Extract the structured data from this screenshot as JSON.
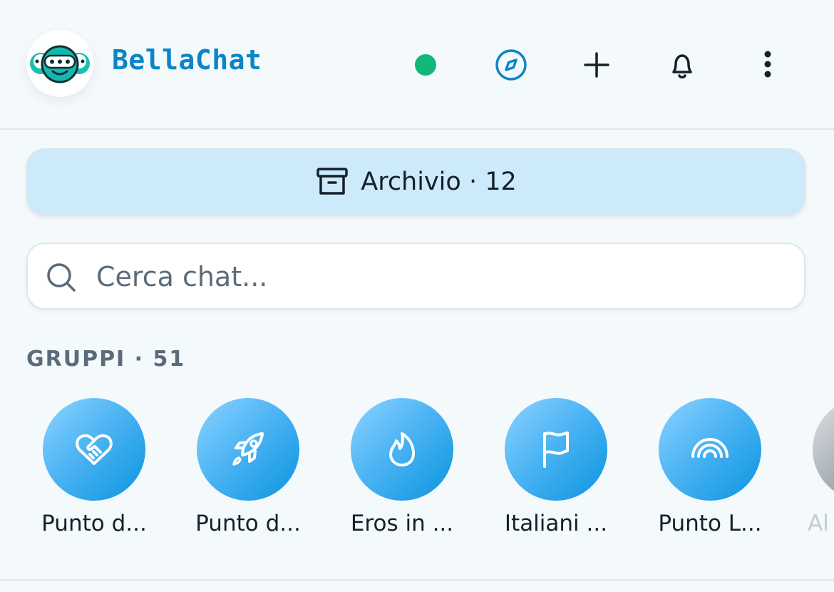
{
  "header": {
    "brand": "BellaChat",
    "icons": [
      "logo",
      "online-status-dot",
      "compass-icon",
      "plus-icon",
      "bell-icon",
      "more-vertical-icon"
    ],
    "colors": {
      "brand": "#0a86c7",
      "online": "#12b877"
    }
  },
  "archive": {
    "label": "Archivio · 12",
    "icon": "archive-icon"
  },
  "search": {
    "placeholder": "Cerca chat...",
    "value": ""
  },
  "groups": {
    "title": "GRUPPI · 51",
    "items": [
      {
        "name": "Punto d...",
        "icon": "heart-handshake-icon"
      },
      {
        "name": "Punto d...",
        "icon": "rocket-icon"
      },
      {
        "name": "Eros in ...",
        "icon": "flame-icon"
      },
      {
        "name": "Italiani ...",
        "icon": "flag-icon"
      },
      {
        "name": "Punto L...",
        "icon": "rainbow-icon"
      },
      {
        "name": "Al",
        "icon": "avatar"
      }
    ]
  }
}
